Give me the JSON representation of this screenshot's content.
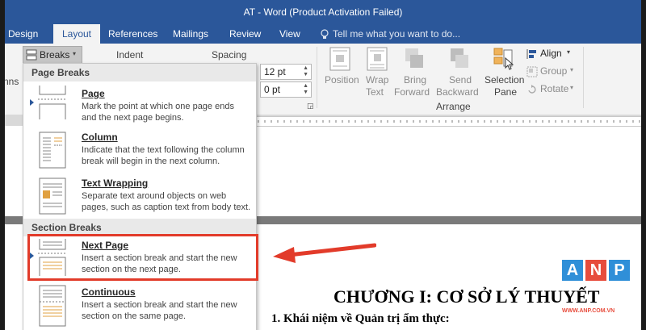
{
  "window": {
    "title": "AT - Word (Product Activation Failed)"
  },
  "tabs": [
    "Design",
    "Layout",
    "References",
    "Mailings",
    "Review",
    "View"
  ],
  "active_tab": "Layout",
  "tell_me": "Tell me what you want to do...",
  "ribbon": {
    "breaks_label": "Breaks",
    "indent_label": "Indent",
    "spacing_label": "Spacing",
    "spacing_before": "12 pt",
    "spacing_after": "0 pt",
    "left_clip": "nns",
    "arrange": {
      "label": "Arrange",
      "position": "Position",
      "wrap_text_1": "Wrap",
      "wrap_text_2": "Text",
      "bring_forward_1": "Bring",
      "bring_forward_2": "Forward",
      "send_backward_1": "Send",
      "send_backward_2": "Backward",
      "selection_pane_1": "Selection",
      "selection_pane_2": "Pane",
      "align": "Align",
      "group": "Group",
      "rotate": "Rotate"
    }
  },
  "breaks_menu": {
    "page_breaks_header": "Page Breaks",
    "section_breaks_header": "Section Breaks",
    "items": [
      {
        "title": "Page",
        "desc1": "Mark the point at which one page ends",
        "desc2": "and the next page begins."
      },
      {
        "title": "Column",
        "desc1": "Indicate that the text following the column",
        "desc2": "break will begin in the next column."
      },
      {
        "title": "Text Wrapping",
        "desc1": "Separate text around objects on web",
        "desc2": "pages, such as caption text from body text."
      },
      {
        "title": "Next Page",
        "desc1": "Insert a section break and start the new",
        "desc2": "section on the next page."
      },
      {
        "title": "Continuous",
        "desc1": "Insert a section break and start the new",
        "desc2": "section on the same page."
      }
    ]
  },
  "document": {
    "heading": "CHƯƠNG I: CƠ SỞ LÝ THUYẾT",
    "subheading": "1.  Khái niệm về Quản trị ẩm thực:"
  },
  "watermark": {
    "letters": [
      "A",
      "N",
      "P"
    ],
    "site": "WWW.ANP.COM.VN"
  },
  "colors": {
    "word_blue": "#2b579a",
    "highlight_red": "#e23b2a"
  }
}
